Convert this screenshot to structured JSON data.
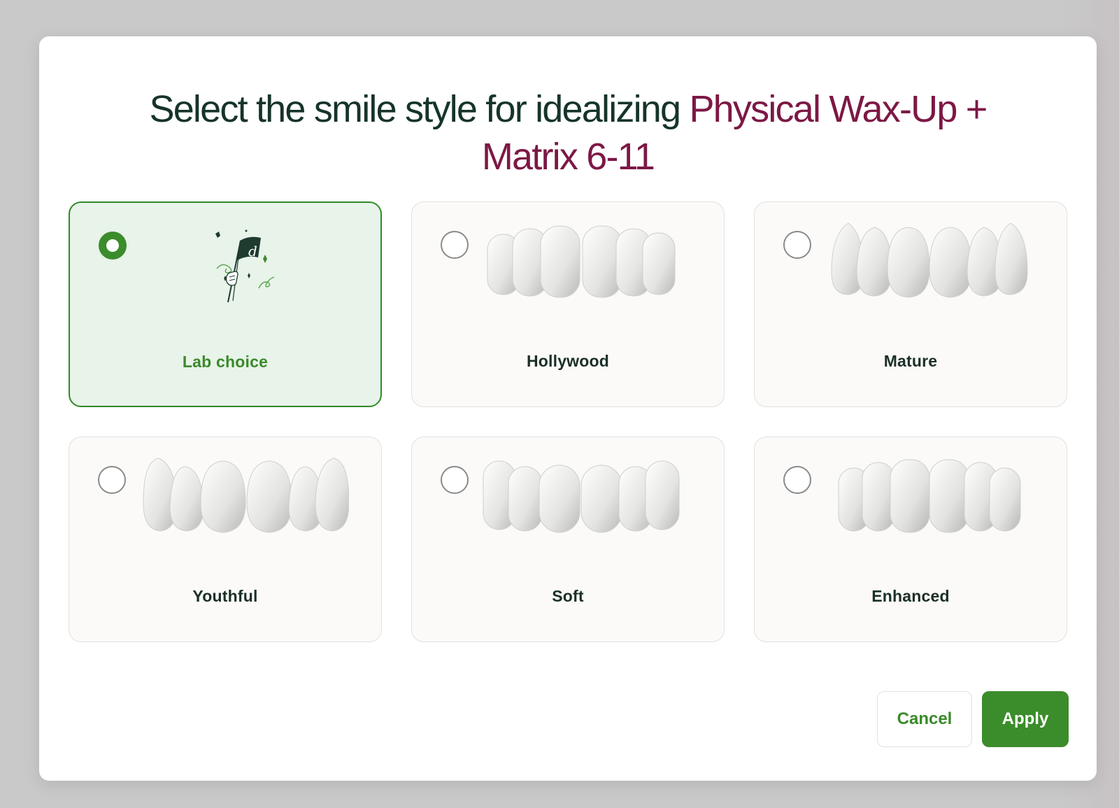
{
  "dialog": {
    "title_prefix": "Select the smile style for idealizing ",
    "title_highlight": "Physical Wax-Up + Matrix 6-11"
  },
  "options": [
    {
      "label": "Lab choice",
      "selected": true,
      "icon": "flag-illustration-icon"
    },
    {
      "label": "Hollywood",
      "selected": false,
      "icon": "teeth-preview-icon"
    },
    {
      "label": "Mature",
      "selected": false,
      "icon": "teeth-preview-icon"
    },
    {
      "label": "Youthful",
      "selected": false,
      "icon": "teeth-preview-icon"
    },
    {
      "label": "Soft",
      "selected": false,
      "icon": "teeth-preview-icon"
    },
    {
      "label": "Enhanced",
      "selected": false,
      "icon": "teeth-preview-icon"
    }
  ],
  "flag_letter": "d",
  "buttons": {
    "cancel": "Cancel",
    "apply": "Apply"
  },
  "colors": {
    "accent_green": "#3b8c2a",
    "title_dark": "#16342a",
    "title_highlight": "#7d1845",
    "selected_card_bg": "#e8f3ea"
  }
}
